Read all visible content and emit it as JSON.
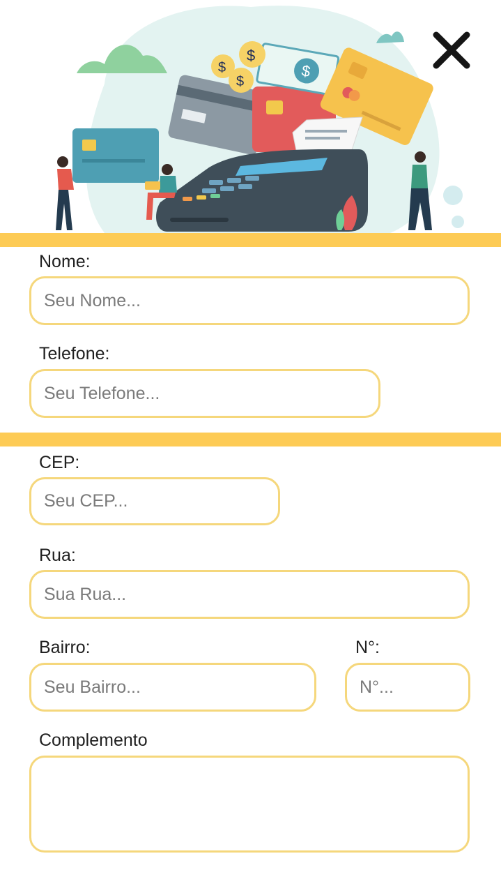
{
  "colors": {
    "accent": "#FDCB55",
    "field_border": "#F5D77C"
  },
  "header": {
    "illustration": "payment-illustration",
    "close_icon": "close-icon"
  },
  "form": {
    "nome": {
      "label": "Nome:",
      "placeholder": "Seu Nome..."
    },
    "telefone": {
      "label": "Telefone:",
      "placeholder": "Seu Telefone..."
    },
    "cep": {
      "label": "CEP:",
      "placeholder": "Seu CEP..."
    },
    "rua": {
      "label": "Rua:",
      "placeholder": "Sua Rua..."
    },
    "bairro": {
      "label": "Bairro:",
      "placeholder": "Seu Bairro..."
    },
    "numero": {
      "label": "N°:",
      "placeholder": "N°..."
    },
    "complemento": {
      "label": "Complemento",
      "placeholder": ""
    }
  }
}
